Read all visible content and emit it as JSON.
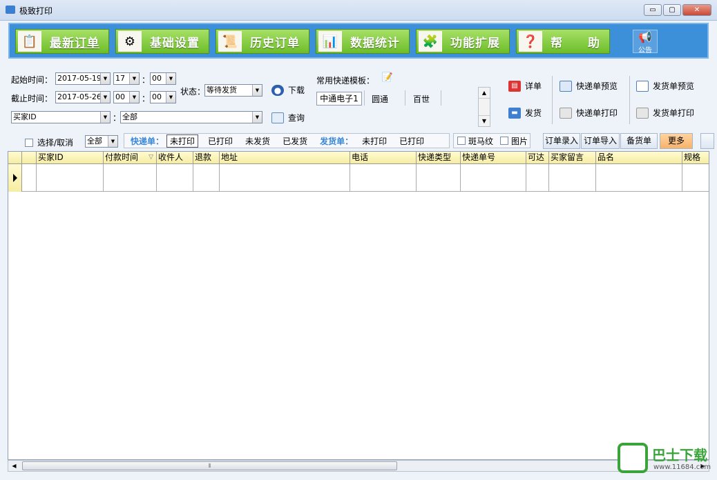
{
  "window": {
    "title": "极致打印",
    "min": "▭",
    "max": "▢",
    "close": "✕"
  },
  "nav": {
    "items": [
      {
        "label": "最新订单",
        "icon": "order-list-icon",
        "glyph": "📋"
      },
      {
        "label": "基础设置",
        "icon": "settings-gear-icon",
        "glyph": "⚙"
      },
      {
        "label": "历史订单",
        "icon": "history-icon",
        "glyph": "📜"
      },
      {
        "label": "数据统计",
        "icon": "bar-chart-icon",
        "glyph": "📊"
      },
      {
        "label": "功能扩展",
        "icon": "extension-icon",
        "glyph": "🧩"
      },
      {
        "label": "帮　　助",
        "icon": "help-icon",
        "glyph": "❓"
      }
    ],
    "notice_label": "公告",
    "notice_icon": "megaphone-icon"
  },
  "query": {
    "start_label": "起始时间：",
    "start_date": "2017-05-19",
    "start_hour": "17",
    "start_min": "00",
    "end_label": "截止时间：",
    "end_date": "2017-05-26",
    "end_hour": "00",
    "end_min": "00",
    "colon": "：",
    "status_label": "状态：",
    "status_value": "等待发货",
    "download": "下载",
    "query": "查询",
    "buyer_field": "买家ID",
    "buyer_value": "全部"
  },
  "templates": {
    "label": "常用快递模板：",
    "items": [
      "中通电子1",
      "圆通",
      "百世"
    ]
  },
  "actions": {
    "detail": "详单",
    "ship": "发货",
    "express_preview": "快递单预览",
    "express_print": "快递单打印",
    "delivery_preview": "发货单预览",
    "delivery_print": "发货单打印"
  },
  "filter": {
    "select_toggle": "选择/取消",
    "scope": "全部",
    "express_label": "快递单：",
    "express_opts": [
      "未打印",
      "已打印",
      "未发货",
      "已发货"
    ],
    "delivery_label": "发货单：",
    "delivery_opts": [
      "未打印",
      "已打印"
    ],
    "zebra": "斑马纹",
    "image": "图片",
    "order_entry": "订单录入",
    "order_import": "订单导入",
    "stock_list": "备货单",
    "more": "更多"
  },
  "grid": {
    "columns": [
      "买家ID",
      "付款时间",
      "收件人",
      "退款",
      "地址",
      "电话",
      "快递类型",
      "快递单号",
      "可达",
      "买家留言",
      "品名",
      "规格"
    ],
    "sort_glyph": "▽"
  },
  "watermark": {
    "name": "巴士下载",
    "url": "www.11684.com"
  },
  "colors": {
    "nav_bg": "#3c8fd9",
    "nav_btn": "#6dbd2a",
    "accent_blue": "#3a87d8",
    "more_btn": "#f7b36a"
  }
}
